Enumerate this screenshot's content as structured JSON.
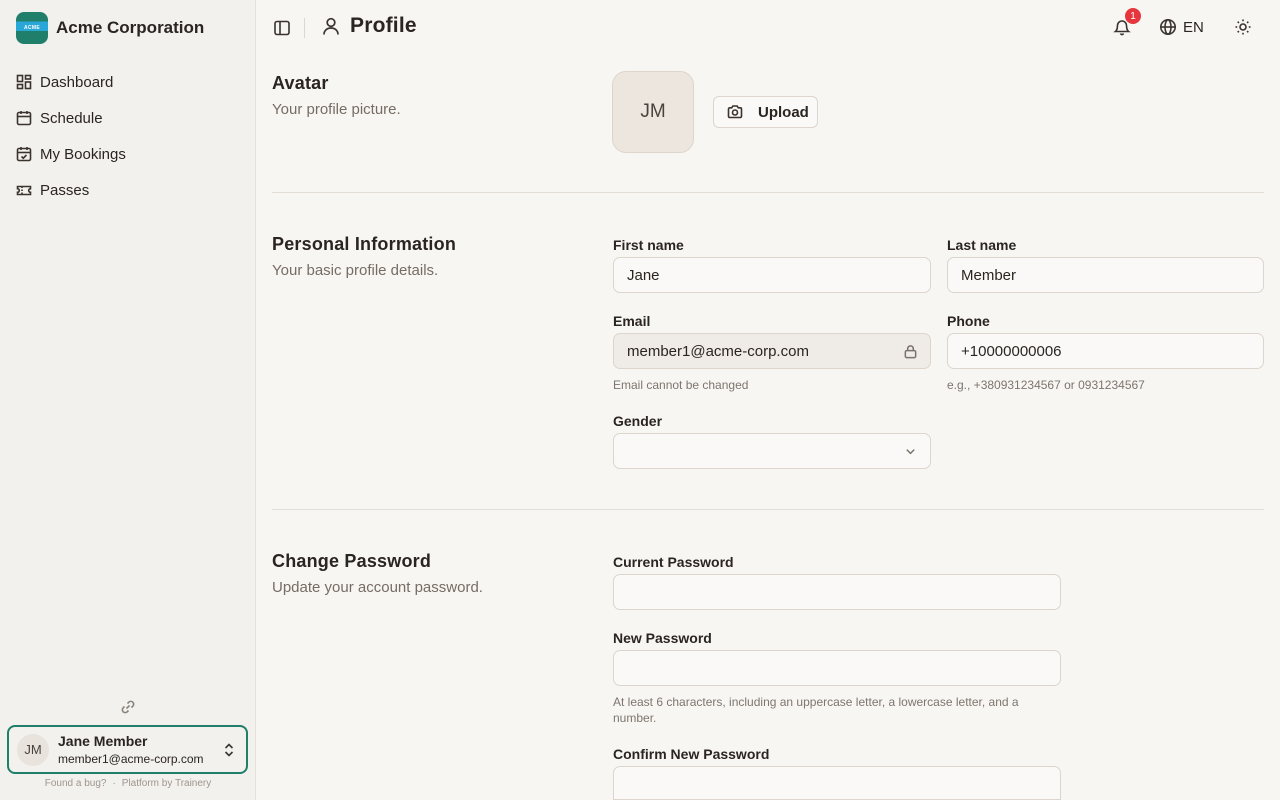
{
  "brand": {
    "name": "Acme Corporation",
    "logo_text": "ACME"
  },
  "sidebar": {
    "items": [
      {
        "label": "Dashboard",
        "icon": "dashboard-icon"
      },
      {
        "label": "Schedule",
        "icon": "calendar-icon"
      },
      {
        "label": "My Bookings",
        "icon": "calendar-check-icon"
      },
      {
        "label": "Passes",
        "icon": "ticket-icon"
      }
    ],
    "user": {
      "initials": "JM",
      "name": "Jane Member",
      "email": "member1@acme-corp.com"
    },
    "footer": {
      "bug_link": "Found a bug?",
      "separator": "·",
      "platform_link": "Platform by Trainery"
    }
  },
  "header": {
    "title": "Profile",
    "notifications_count": "1",
    "language": "EN"
  },
  "avatar_section": {
    "title": "Avatar",
    "description": "Your profile picture.",
    "initials": "JM",
    "upload_label": "Upload"
  },
  "personal_section": {
    "title": "Personal Information",
    "description": "Your basic profile details.",
    "first_name": {
      "label": "First name",
      "value": "Jane"
    },
    "last_name": {
      "label": "Last name",
      "value": "Member"
    },
    "email": {
      "label": "Email",
      "value": "member1@acme-corp.com",
      "hint": "Email cannot be changed"
    },
    "phone": {
      "label": "Phone",
      "value": "+10000000006",
      "hint": "e.g., +380931234567 or 0931234567"
    },
    "gender": {
      "label": "Gender",
      "value": ""
    }
  },
  "password_section": {
    "title": "Change Password",
    "description": "Update your account password.",
    "current": {
      "label": "Current Password",
      "value": ""
    },
    "new": {
      "label": "New Password",
      "value": "",
      "hint": "At least 6 characters, including an uppercase letter, a lowercase letter, and a number."
    },
    "confirm": {
      "label": "Confirm New Password",
      "value": ""
    }
  },
  "colors": {
    "accent": "#1f7f6a",
    "badge": "#e5363d",
    "background": "#f8f6f3",
    "sidebar": "#f3f1ed"
  }
}
